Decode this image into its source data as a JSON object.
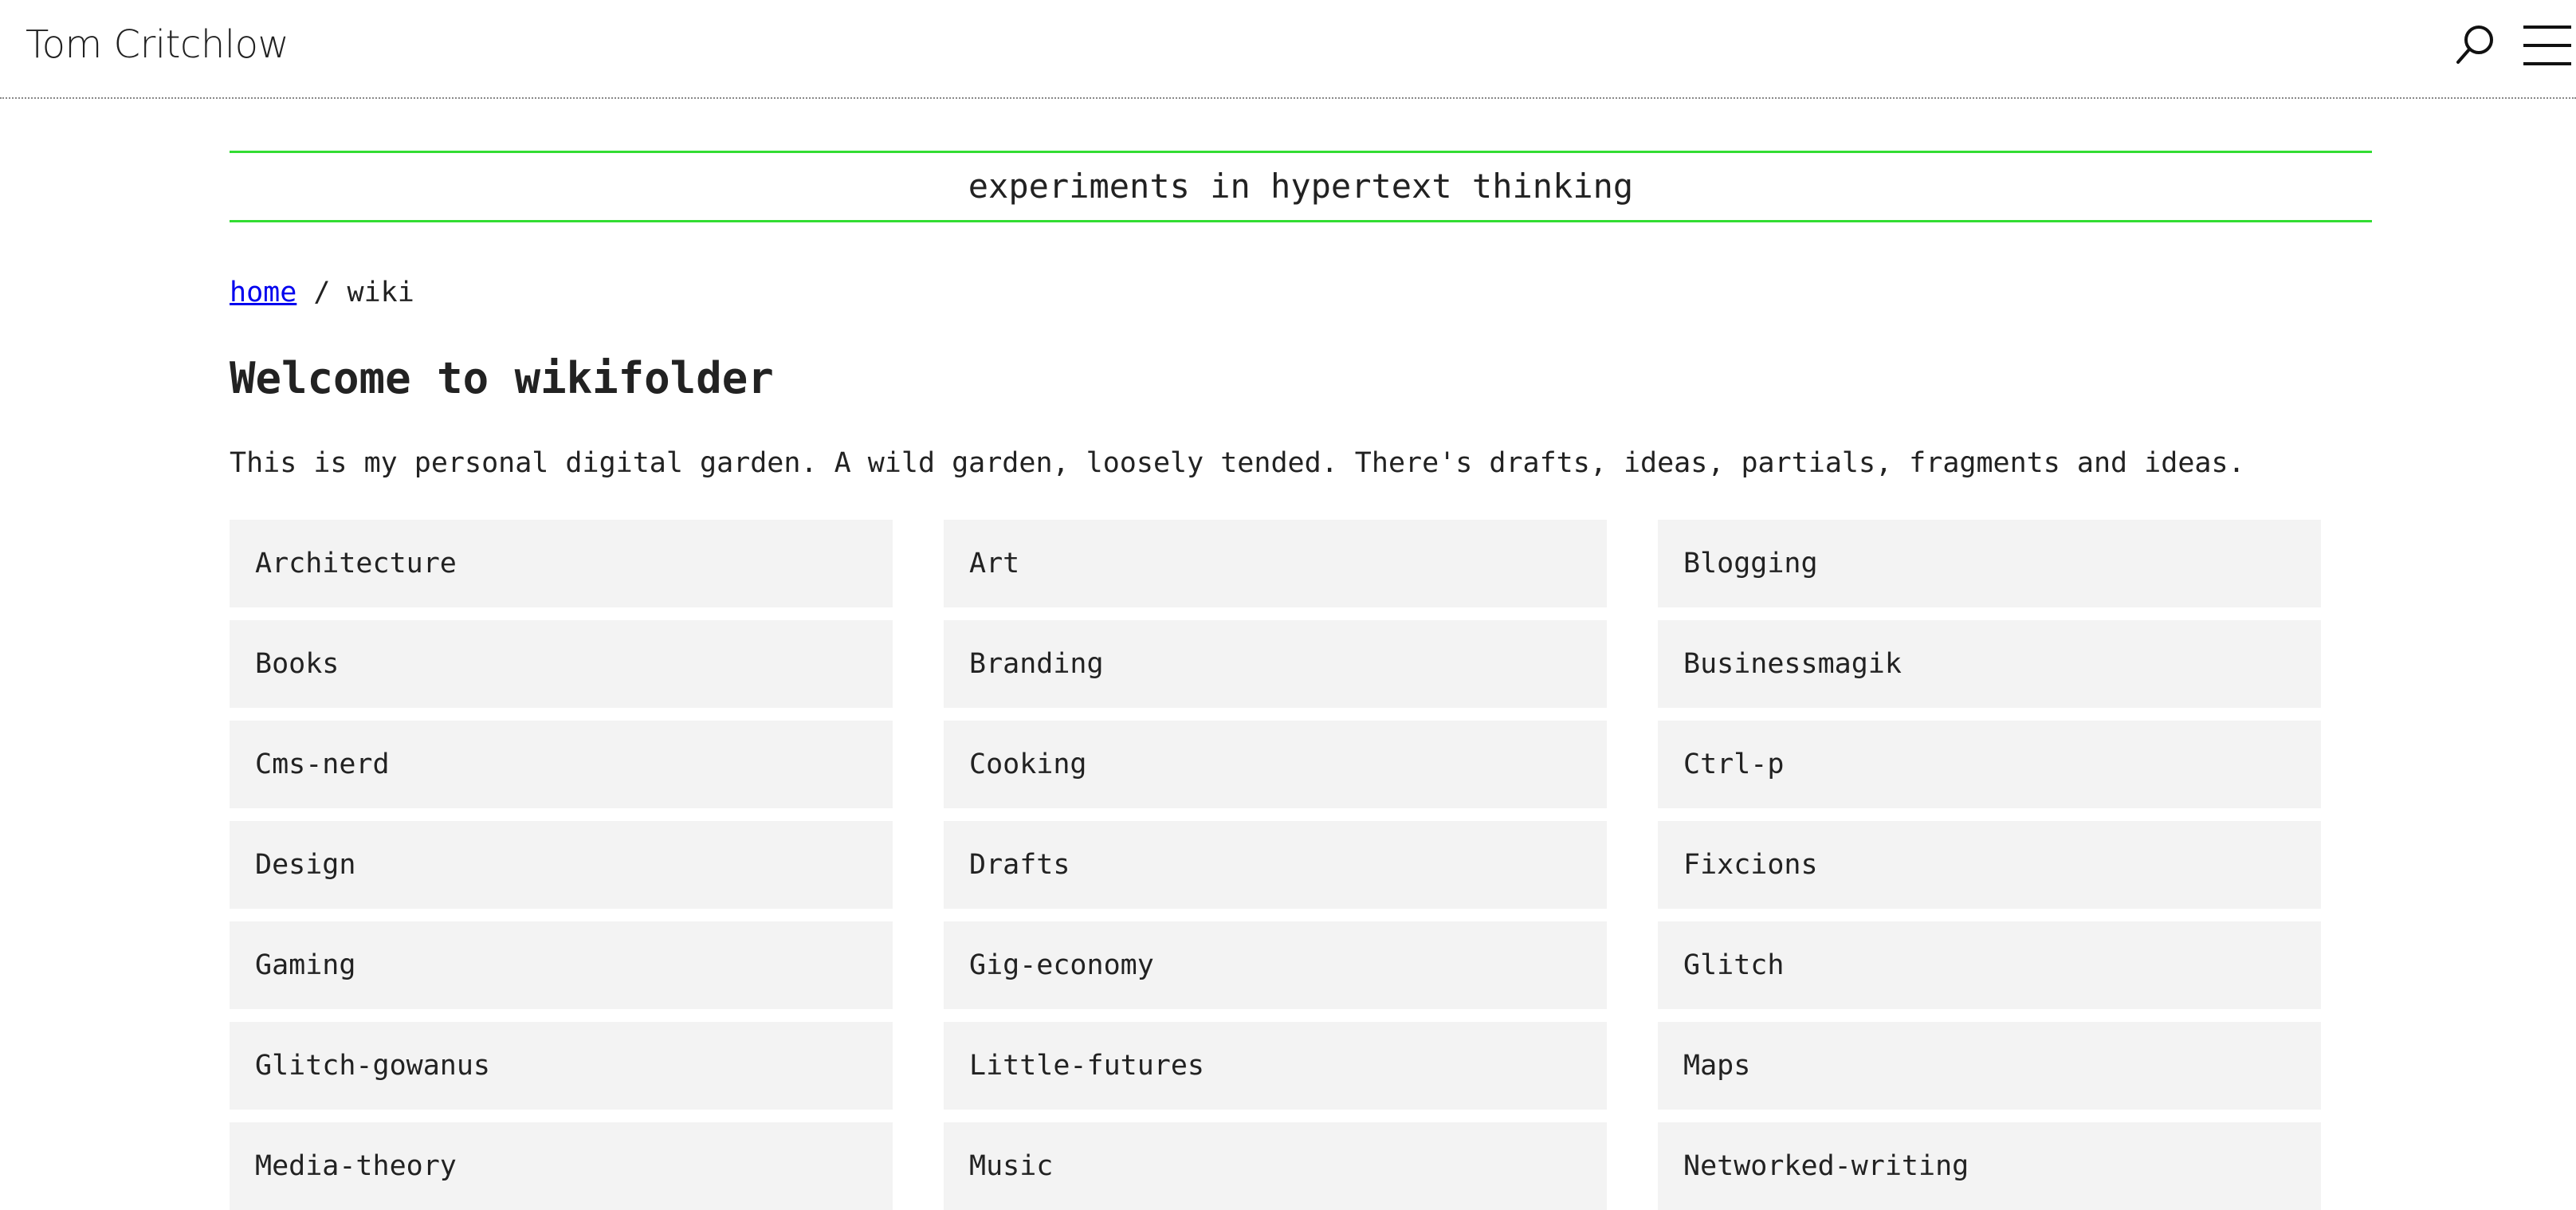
{
  "header": {
    "site_title": "Tom Critchlow",
    "search_icon": "search-icon",
    "menu_icon": "hamburger-menu-icon"
  },
  "banner": {
    "text": "experiments in hypertext thinking",
    "accent_color": "#33dd33"
  },
  "breadcrumb": {
    "home_label": "home",
    "separator": " / ",
    "current": "wiki"
  },
  "main": {
    "title": "Welcome to wikifolder",
    "intro": "This is my personal digital garden. A wild garden, loosely tended. There's drafts, ideas, partials, fragments and ideas."
  },
  "categories": [
    "Architecture",
    "Art",
    "Blogging",
    "Books",
    "Branding",
    "Businessmagik",
    "Cms-nerd",
    "Cooking",
    "Ctrl-p",
    "Design",
    "Drafts",
    "Fixcions",
    "Gaming",
    "Gig-economy",
    "Glitch",
    "Glitch-gowanus",
    "Little-futures",
    "Maps",
    "Media-theory",
    "Music",
    "Networked-writing"
  ]
}
